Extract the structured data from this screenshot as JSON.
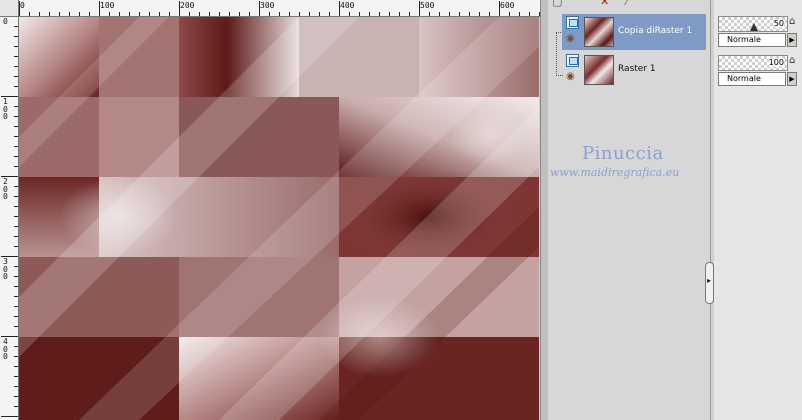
{
  "rulers": {
    "top_labels": [
      "0",
      "100",
      "200",
      "300",
      "400",
      "500",
      "600"
    ],
    "left_labels": [
      "0",
      "100",
      "200",
      "300",
      "400"
    ]
  },
  "layers": [
    {
      "name": "Copia diRaster 1",
      "selected": true,
      "opacity": "50",
      "blend": "Normale"
    },
    {
      "name": "Raster 1",
      "selected": false,
      "opacity": "100",
      "blend": "Normale"
    }
  ],
  "watermark": {
    "title": "Pinuccia",
    "url": "www.maidiregrafica.eu"
  },
  "colors": {
    "selection": "#7f9bc5",
    "watermark": "#8e9fcf",
    "image_dark": "#5a1a18",
    "image_light": "#f2e6e6"
  },
  "icons": [
    "eye-icon",
    "layer-visibility-icon",
    "lock-icon",
    "arrow-right-icon",
    "delete-icon",
    "brush-icon"
  ]
}
